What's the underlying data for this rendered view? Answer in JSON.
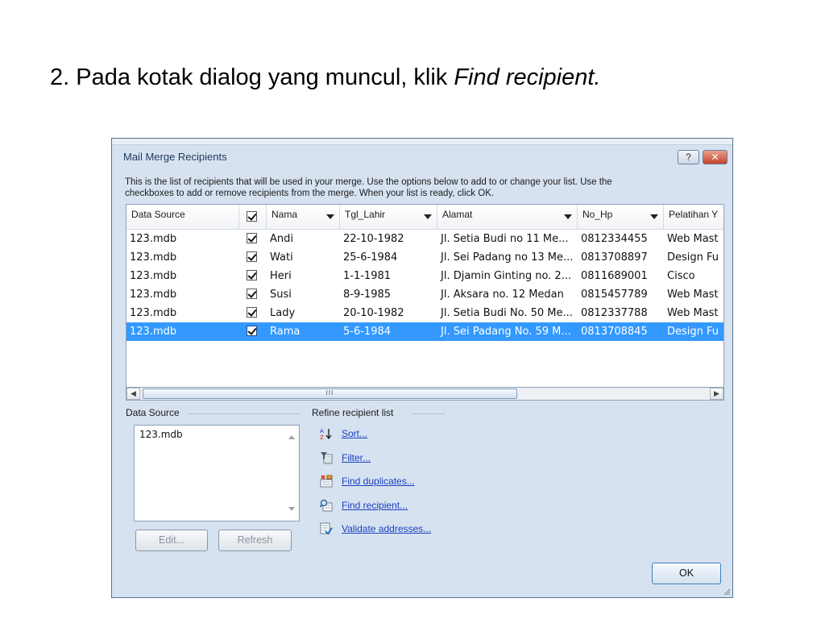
{
  "slide": {
    "title_prefix": "2. Pada kotak dialog yang muncul, klik ",
    "title_emphasis": "Find recipient."
  },
  "dialog": {
    "title": "Mail Merge Recipients",
    "help_label": "?",
    "close_label": "✕",
    "description_line1": "This is the list of recipients that will be used in your merge.  Use the options below to add to or change your list.  Use the",
    "description_line2": "checkboxes to add or remove recipients from the merge.  When your list is ready, click OK."
  },
  "table": {
    "columns": [
      "Data Source",
      "",
      "Nama",
      "Tgl_Lahir",
      "Alamat",
      "No_Hp",
      "Pelatihan Y"
    ],
    "rows": [
      {
        "source": "123.mdb",
        "checked": true,
        "nama": "Andi",
        "tgl": "22-10-1982",
        "alamat": "Jl. Setia Budi no 11 Me...",
        "hp": "0812334455",
        "pelatihan": "Web Mast",
        "selected": false
      },
      {
        "source": "123.mdb",
        "checked": true,
        "nama": "Wati",
        "tgl": "25-6-1984",
        "alamat": "Jl. Sei Padang no 13 Me...",
        "hp": "0813708897",
        "pelatihan": "Design Fu",
        "selected": false
      },
      {
        "source": "123.mdb",
        "checked": true,
        "nama": "Heri",
        "tgl": "1-1-1981",
        "alamat": "Jl. Djamin Ginting no. 2...",
        "hp": "0811689001",
        "pelatihan": "Cisco",
        "selected": false
      },
      {
        "source": "123.mdb",
        "checked": true,
        "nama": "Susi",
        "tgl": "8-9-1985",
        "alamat": "Jl. Aksara no. 12 Medan",
        "hp": "0815457789",
        "pelatihan": "Web Mast",
        "selected": false
      },
      {
        "source": "123.mdb",
        "checked": true,
        "nama": "Lady",
        "tgl": "20-10-1982",
        "alamat": "Jl. Setia Budi No. 50 Me...",
        "hp": "0812337788",
        "pelatihan": "Web Mast",
        "selected": false
      },
      {
        "source": "123.mdb",
        "checked": true,
        "nama": "Rama",
        "tgl": "5-6-1984",
        "alamat": "Jl. Sei Padang No. 59 M...",
        "hp": "0813708845",
        "pelatihan": "Design Fu",
        "selected": true
      }
    ],
    "scroll_thumb_label": "III"
  },
  "data_source_panel": {
    "label": "Data Source",
    "items": [
      "123.mdb"
    ],
    "edit_label": "Edit...",
    "refresh_label": "Refresh"
  },
  "refine_panel": {
    "label": "Refine recipient list",
    "items": [
      {
        "label": "Sort...",
        "icon": "sort-az-icon"
      },
      {
        "label": "Filter...",
        "icon": "filter-icon"
      },
      {
        "label": "Find duplicates...",
        "icon": "find-duplicates-icon"
      },
      {
        "label": "Find recipient...",
        "icon": "find-recipient-icon"
      },
      {
        "label": "Validate addresses...",
        "icon": "validate-addresses-icon"
      }
    ]
  },
  "footer": {
    "ok_label": "OK"
  },
  "colors": {
    "dialog_bg": "#d7e2f1",
    "selection": "#3399ff",
    "link": "#1a3fbf"
  }
}
